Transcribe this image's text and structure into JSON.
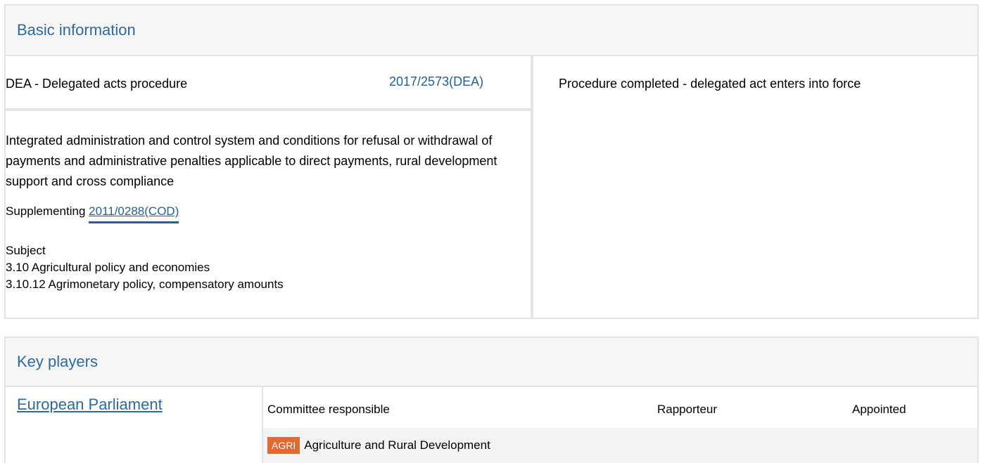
{
  "basic_info": {
    "title": "Basic information",
    "procedure_type": "DEA - Delegated acts procedure",
    "procedure_reference": "2017/2573(DEA)",
    "status": "Procedure completed - delegated act enters into force",
    "description": "Integrated administration and control system and conditions for refusal or withdrawal of payments and administrative penalties applicable to direct payments, rural development support and cross compliance",
    "supplementing_label": "Supplementing",
    "supplementing_link": "2011/0288(COD)",
    "subject_label": "Subject",
    "subjects": [
      "3.10 Agricultural policy and economies",
      "3.10.12 Agrimonetary policy, compensatory amounts"
    ]
  },
  "key_players": {
    "title": "Key players",
    "institution": "European Parliament",
    "columns": {
      "committee": "Committee responsible",
      "rapporteur": "Rapporteur",
      "appointed": "Appointed"
    },
    "committee": {
      "badge": "AGRI",
      "name": "Agriculture and Rural Development"
    }
  },
  "colors": {
    "heading_blue": "#2c6aa3",
    "link_blue": "#1f5f9a",
    "badge_orange": "#e06a33",
    "border_gray": "#e4e4e4",
    "header_bg": "#f6f6f6",
    "row_bg": "#f3f3f3"
  }
}
